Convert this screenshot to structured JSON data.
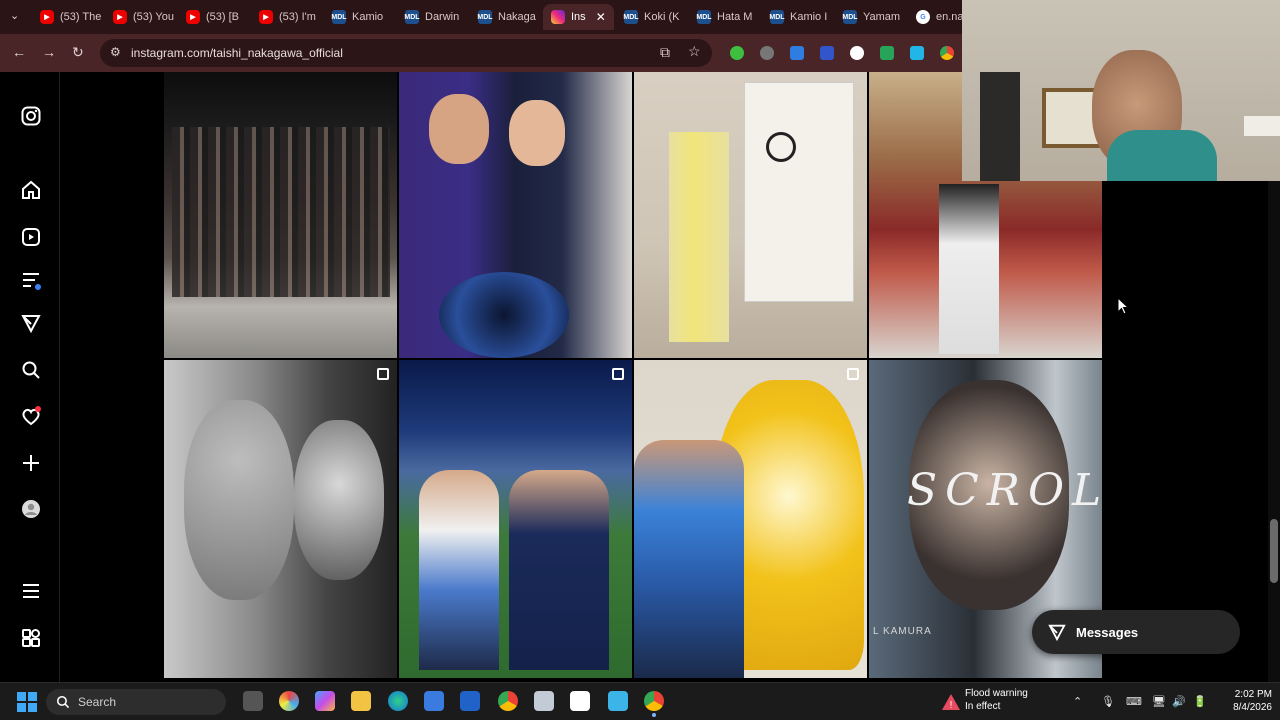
{
  "browser": {
    "tabs": [
      {
        "label": "(53) The",
        "icon": "youtube-icon"
      },
      {
        "label": "(53) You",
        "icon": "youtube-icon"
      },
      {
        "label": "(53) [B",
        "icon": "youtube-icon"
      },
      {
        "label": "(53) I'm",
        "icon": "youtube-icon"
      },
      {
        "label": "Kamio",
        "icon": "mdl-icon"
      },
      {
        "label": "Darwin",
        "icon": "mdl-icon"
      },
      {
        "label": "Nakaga",
        "icon": "mdl-icon"
      },
      {
        "label": "Ins",
        "icon": "instagram-icon",
        "active": true
      },
      {
        "label": "Koki (K",
        "icon": "mdl-icon"
      },
      {
        "label": "Hata M",
        "icon": "mdl-icon"
      },
      {
        "label": "Kamio I",
        "icon": "mdl-icon"
      },
      {
        "label": "Yamam",
        "icon": "mdl-icon"
      },
      {
        "label": "en.na",
        "icon": "google-icon"
      }
    ],
    "url": "instagram.com/taishi_nakagawa_official",
    "accent": "#4a2528"
  },
  "instagram": {
    "sidebar_icons": [
      "instagram-logo-icon",
      "home-icon",
      "reels-icon",
      "feed-icon",
      "explore-icon",
      "search-icon",
      "notifications-icon",
      "create-icon",
      "profile-icon",
      "more-icon",
      "also-from-meta-icon"
    ],
    "grid_overlay_text": "SCROLL",
    "grid_small_text": "L KAMURA",
    "messages_label": "Messages"
  },
  "taskbar": {
    "search_placeholder": "Search",
    "weather_title": "Flood warning",
    "weather_sub": "In effect",
    "time": "2:02 PM",
    "date": "8/4/2026"
  }
}
